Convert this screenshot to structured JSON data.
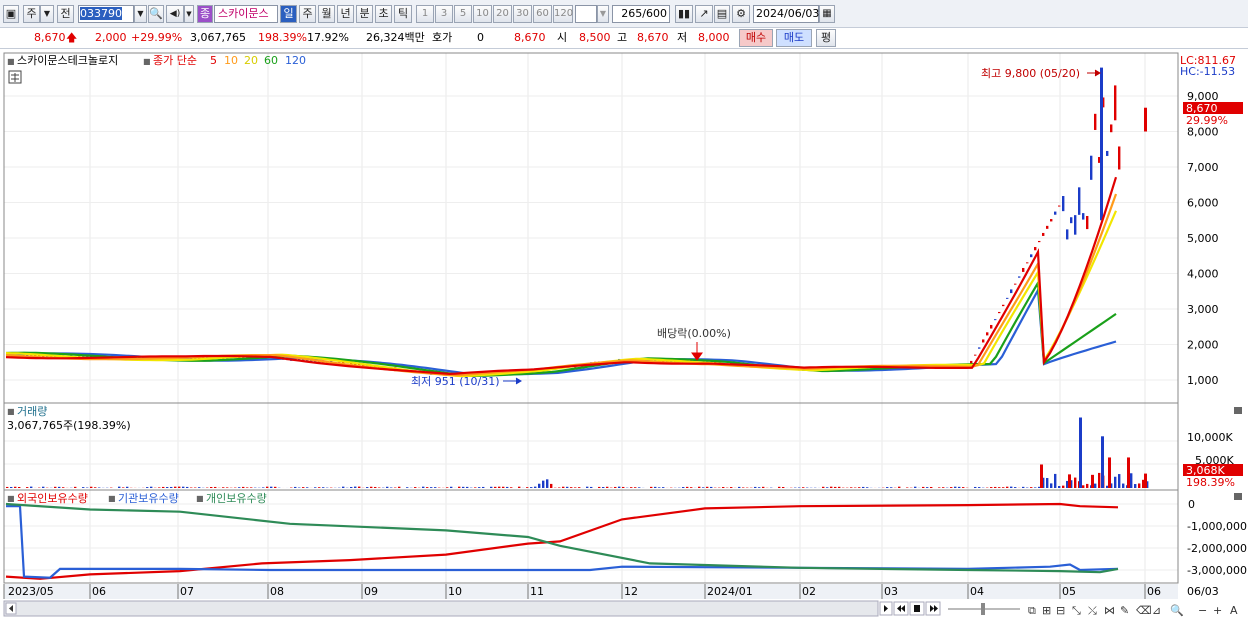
{
  "toolbar": {
    "type_label": "주",
    "scope_label": "전",
    "code": "033790",
    "stock_badge": "종",
    "stock_name": "스카이문스",
    "periods": [
      "일",
      "주",
      "월",
      "년",
      "분",
      "초",
      "틱"
    ],
    "active_period": "일",
    "intervals": [
      "1",
      "3",
      "5",
      "10",
      "20",
      "30",
      "60",
      "120"
    ],
    "count_value": "265",
    "count_total": "/600",
    "date": "2024/06/03"
  },
  "quote": {
    "price": "8,670",
    "change": "2,000",
    "change_pct": "+29.99%",
    "volume": "3,067,765",
    "volume_ratio": "198.39%",
    "turnover": "17.92%",
    "amount": "26,324백만",
    "hoga_label": "호가",
    "hoga_value": "0",
    "hoga_price": "8,670",
    "open_label": "시",
    "open": "8,500",
    "high_label": "고",
    "high": "8,670",
    "low_label": "저",
    "low": "8,000",
    "buy_label": "매수",
    "sell_label": "매도",
    "avg_label": "평"
  },
  "price_panel": {
    "legend_name": "스카이문스테크놀로지",
    "legend_ma": "종가 단순",
    "ma_periods": [
      {
        "label": "5",
        "color": "#e00000"
      },
      {
        "label": "10",
        "color": "#ff9b1a"
      },
      {
        "label": "20",
        "color": "#f2e600"
      },
      {
        "label": "60",
        "color": "#1aa01a"
      },
      {
        "label": "120",
        "color": "#2a5fd6"
      }
    ],
    "lc": "LC:811.67",
    "hc": "HC:-11.53",
    "high_annotation": "최고 9,800 (05/20)",
    "low_annotation": "최저 951 (10/31)",
    "dividend_annotation": "배당락(0.00%)",
    "last_price_tag": "8,670",
    "last_pct_tag": "29.99%",
    "y_ticks": [
      "9,000",
      "8,000",
      "7,000",
      "6,000",
      "5,000",
      "4,000",
      "3,000",
      "2,000",
      "1,000"
    ]
  },
  "volume_panel": {
    "title": "거래량",
    "value": "3,067,765주(198.39%)",
    "y_ticks": [
      "10,000K",
      "5,000K"
    ],
    "last_tag": "3,068K",
    "last_pct": "198.39%"
  },
  "holder_panel": {
    "series": [
      {
        "name": "외국인보유수량",
        "color": "#e00000"
      },
      {
        "name": "기관보유수량",
        "color": "#2a5fd6"
      },
      {
        "name": "개인보유수량",
        "color": "#2e8b57"
      }
    ],
    "y_ticks": [
      "0",
      "-1,000,000",
      "-2,000,000",
      "-3,000,000"
    ]
  },
  "x_axis": {
    "labels": [
      "2023/05",
      "06",
      "07",
      "08",
      "09",
      "10",
      "11",
      "12",
      "2024/01",
      "02",
      "03",
      "04",
      "05",
      "06"
    ],
    "right_label": "06/03"
  },
  "chart_data": {
    "type": "line",
    "x": [
      "2023/05",
      "06",
      "07",
      "08",
      "09",
      "10",
      "11",
      "12",
      "2024/01",
      "02",
      "03",
      "04",
      "05",
      "06"
    ],
    "series": [
      {
        "name": "종가",
        "values": [
          1700,
          1650,
          1600,
          1650,
          1400,
          1150,
          1250,
          1550,
          1500,
          1300,
          1350,
          1400,
          6000,
          8670
        ]
      }
    ],
    "ylim": [
      500,
      10000
    ],
    "annotations": [
      "최고 9,800 (05/20)",
      "최저 951 (10/31)",
      "배당락(0.00%)"
    ]
  },
  "colors": {
    "up": "#e00000",
    "down": "#1b3cc8",
    "accent": "#2b5fbf"
  }
}
